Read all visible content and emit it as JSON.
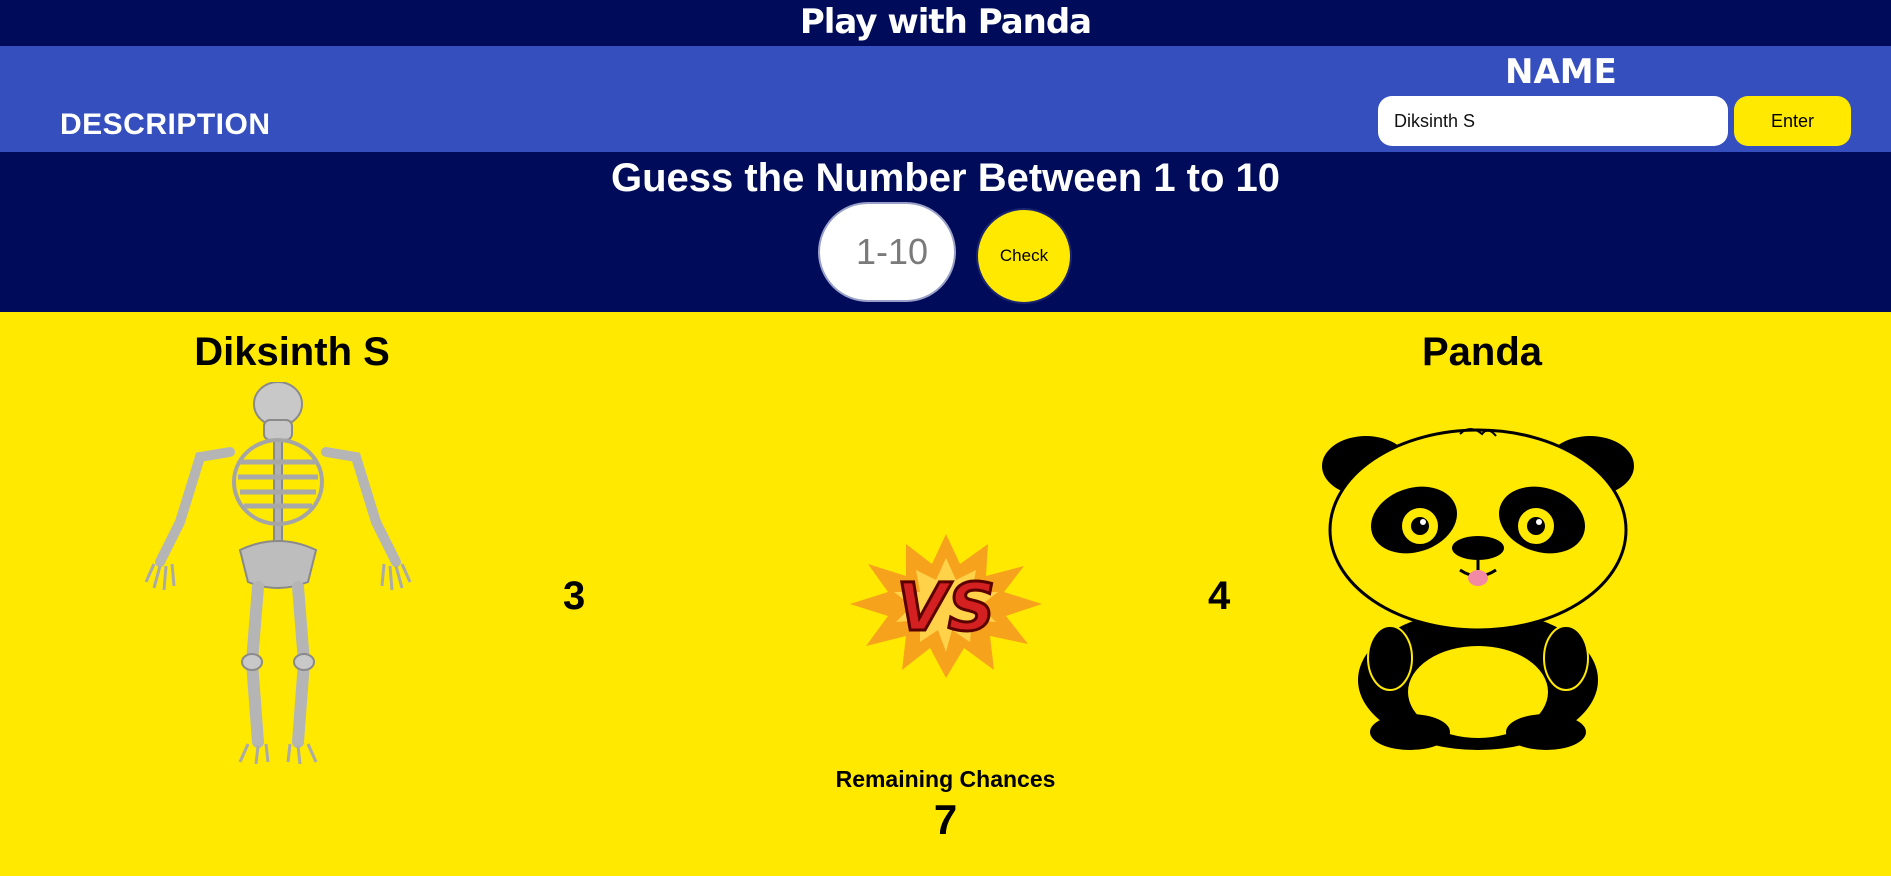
{
  "header": {
    "title": "Play with Panda",
    "description_label": "DESCRIPTION",
    "name_label": "NAME",
    "name_input_value": "Diksinth S",
    "enter_label": "Enter"
  },
  "game": {
    "prompt": "Guess the Number Between 1 to 10",
    "guess_placeholder": "1-10",
    "check_label": "Check"
  },
  "arena": {
    "player_name": "Diksinth S",
    "player_score": "3",
    "opponent_name": "Panda",
    "opponent_score": "4",
    "remaining_label": "Remaining Chances",
    "remaining_value": "7"
  },
  "colors": {
    "dark_navy": "#000b59",
    "header_blue": "#354fbe",
    "yellow": "#ffe900"
  },
  "icons": {
    "player_avatar": "skeleton-icon",
    "vs_badge": "vs-icon",
    "opponent_avatar": "panda-icon"
  }
}
